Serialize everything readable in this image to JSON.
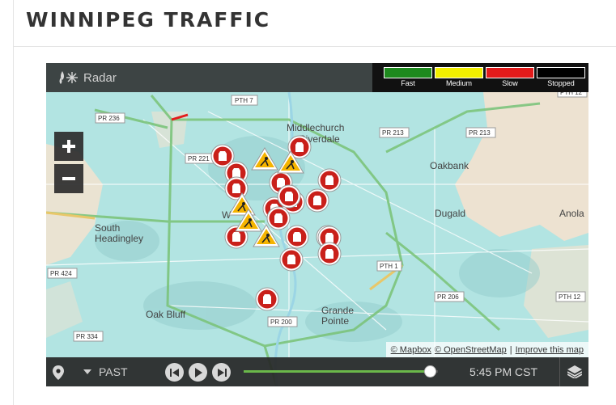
{
  "page": {
    "title": "WINNIPEG TRAFFIC"
  },
  "radar": {
    "label": "Radar",
    "icon": "radar-icon"
  },
  "legend": {
    "items": [
      {
        "label": "Fast",
        "color": "#1e8a1e"
      },
      {
        "label": "Medium",
        "color": "#f2ef00"
      },
      {
        "label": "Slow",
        "color": "#e31b1b"
      },
      {
        "label": "Stopped",
        "color": "#000000"
      }
    ]
  },
  "zoom": {
    "in_icon": "plus-icon",
    "out_icon": "minus-icon"
  },
  "map": {
    "places": {
      "middlechurch": "Middlechurch",
      "riverdale": "Riverdale",
      "oakbank": "Oakbank",
      "dugald": "Dugald",
      "anola": "Anola",
      "south_headingley": "South\nHeadingley",
      "oak_bluff": "Oak Bluff",
      "grande_pointe": "Grande\nPointe",
      "winnipeg_partial": "W"
    },
    "route_shields": [
      "PTH 7",
      "PR 236",
      "PR 213",
      "PR 213",
      "PTH 12",
      "PR 221",
      "PR 424",
      "PTH 1",
      "PR 206",
      "PTH 12",
      "PR 200",
      "PR 334"
    ],
    "incident_icons": {
      "closure": "road-closure-icon",
      "construction": "construction-icon"
    },
    "attribution": {
      "mapbox": "© Mapbox",
      "osm": "© OpenStreetMap",
      "separator": "|",
      "improve": "Improve this map"
    },
    "colors": {
      "water_radar": "#b2e4e2",
      "land": "#f0e2d0",
      "highway": "#e8c76a",
      "road": "#ffffff"
    }
  },
  "controls": {
    "location_icon": "map-pin-icon",
    "mode_label": "PAST",
    "skip_back_icon": "skip-back-icon",
    "play_icon": "play-icon",
    "skip_forward_icon": "skip-forward-icon",
    "timeline_progress": 0.96,
    "time": "5:45 PM CST",
    "layers_icon": "layers-icon"
  }
}
